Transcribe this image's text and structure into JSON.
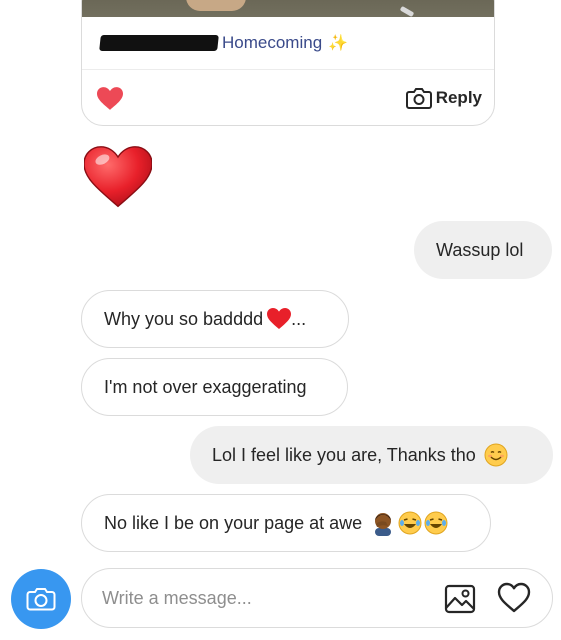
{
  "story_reply": {
    "caption": "Homecoming",
    "caption_emoji": "sparkles-icon",
    "reply_label": "Reply",
    "reaction": "heart-icon"
  },
  "messages": [
    {
      "side": "them",
      "type": "emoji",
      "emoji": "red-heart-icon"
    },
    {
      "side": "me",
      "text": "Wassup lol"
    },
    {
      "side": "them",
      "text": "Why you so badddd",
      "suffix": "...",
      "emoji": "red-heart-icon"
    },
    {
      "side": "them",
      "text": "I'm not over exaggerating"
    },
    {
      "side": "me",
      "text": "Lol I feel like you are, Thanks tho",
      "emoji": "smiling-face-icon"
    },
    {
      "side": "them",
      "text": "No like I be on your page at awe",
      "emoji": "man-facepalming-icon, tears-of-joy-icon, tears-of-joy-icon"
    }
  ],
  "composer": {
    "placeholder": "Write a message...",
    "value": ""
  },
  "colors": {
    "accent": "#3897f0",
    "heart": "#ed4956",
    "bubble_out": "#efefef",
    "border": "#dbdbdb"
  }
}
